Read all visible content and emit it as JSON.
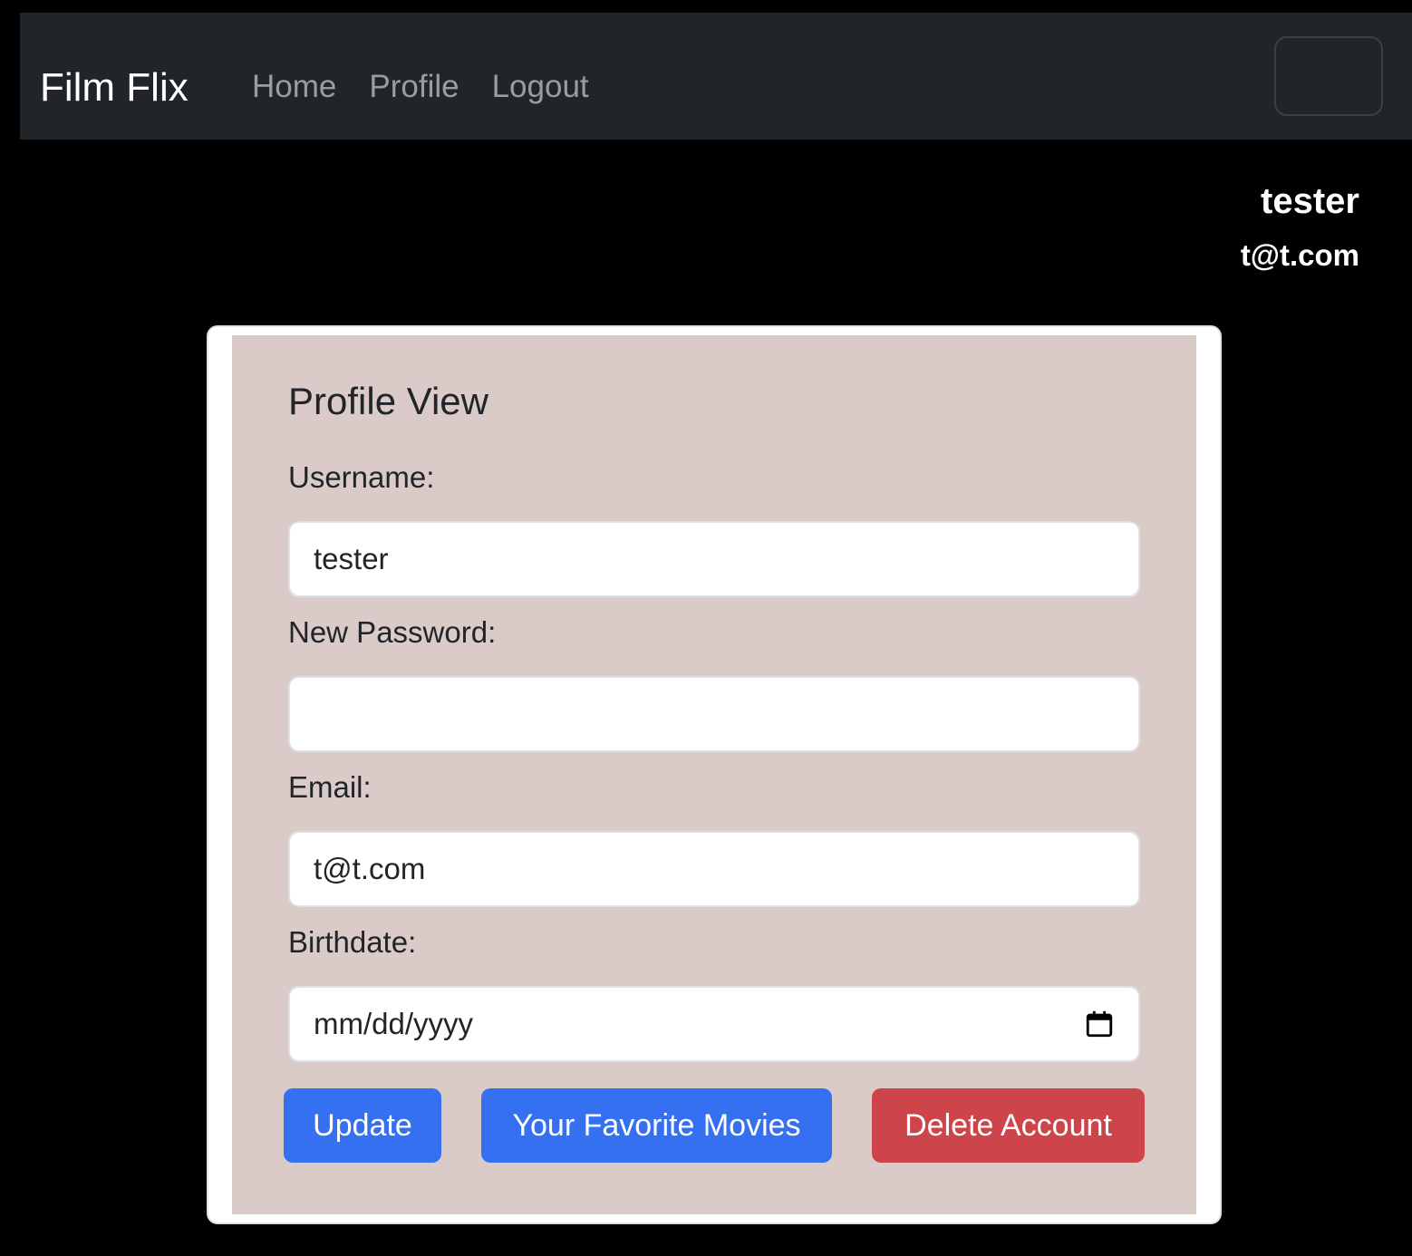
{
  "navbar": {
    "brand": "Film Flix",
    "links": [
      "Home",
      "Profile",
      "Logout"
    ]
  },
  "user": {
    "username": "tester",
    "email": "t@t.com"
  },
  "form": {
    "title": "Profile View",
    "username_label": "Username:",
    "username_value": "tester",
    "password_label": "New Password:",
    "password_value": "",
    "email_label": "Email:",
    "email_value": "t@t.com",
    "birthdate_label": "Birthdate:",
    "birthdate_placeholder": "mm/dd/yyyy"
  },
  "buttons": {
    "update": "Update",
    "favorites": "Your Favorite Movies",
    "delete": "Delete Account"
  },
  "colors": {
    "navbar": "#212529",
    "card_body": "#dacbc8",
    "primary": "#3470f0",
    "danger": "#cd444b"
  }
}
